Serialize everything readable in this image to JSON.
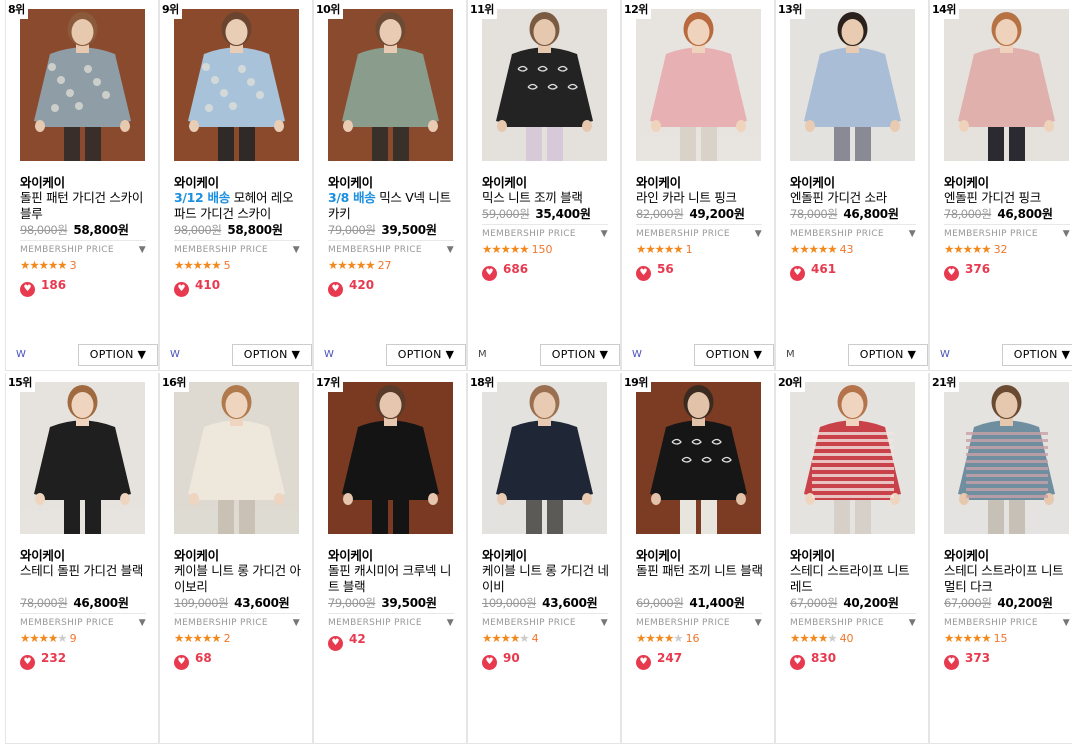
{
  "products": [
    {
      "rank": "8위",
      "brand": "와이케이",
      "ship": "",
      "name": "돌핀 패턴 가디건 스카이블루",
      "orig": "98,000원",
      "sale": "58,800원",
      "member": "MEMBERSHIP PRICE",
      "stars": 5,
      "rating": "3",
      "likes": "186",
      "flag": "W",
      "option": "OPTION ▼",
      "img": {
        "bg": "#8a4a2e",
        "top": "#8f9ea6",
        "pants": "#3a2e2a",
        "hair": "#8a5a3a",
        "skin": "#e7c9b0"
      }
    },
    {
      "rank": "9위",
      "brand": "와이케이",
      "ship": "3/12 배송",
      "name": "모헤어 레오파드 가디건 스카이",
      "orig": "98,000원",
      "sale": "58,800원",
      "member": "MEMBERSHIP PRICE",
      "stars": 5,
      "rating": "5",
      "likes": "410",
      "flag": "W",
      "option": "OPTION ▼",
      "img": {
        "bg": "#8b4a2c",
        "top": "#a8c3d9",
        "pants": "#2f2a28",
        "hair": "#6b4430",
        "skin": "#e9cdb5"
      }
    },
    {
      "rank": "10위",
      "brand": "와이케이",
      "ship": "3/8 배송",
      "name": "믹스 V넥 니트 카키",
      "orig": "79,000원",
      "sale": "39,500원",
      "member": "MEMBERSHIP PRICE",
      "stars": 5,
      "rating": "27",
      "likes": "420",
      "flag": "W",
      "option": "OPTION ▼",
      "img": {
        "bg": "#8a4a2d",
        "top": "#8a9c8c",
        "pants": "#3a302a",
        "hair": "#6d4a34",
        "skin": "#e8cbb2"
      }
    },
    {
      "rank": "11위",
      "brand": "와이케이",
      "ship": "",
      "name": "믹스 니트 조끼 블랙",
      "orig": "59,000원",
      "sale": "35,400원",
      "member": "MEMBERSHIP PRICE",
      "stars": 5,
      "rating": "150",
      "likes": "686",
      "flag": "M",
      "option": "OPTION ▼",
      "img": {
        "bg": "#e4e1dc",
        "top": "#232323",
        "pants": "#d8c9d8",
        "hair": "#7a5a40",
        "skin": "#e6c8ae"
      }
    },
    {
      "rank": "12위",
      "brand": "와이케이",
      "ship": "",
      "name": "라인 카라 니트 핑크",
      "orig": "82,000원",
      "sale": "49,200원",
      "member": "MEMBERSHIP PRICE",
      "stars": 5,
      "rating": "1",
      "likes": "56",
      "flag": "W",
      "option": "OPTION ▼",
      "img": {
        "bg": "#e7e4df",
        "top": "#e7b1b3",
        "pants": "#d9d2c8",
        "hair": "#b86a3e",
        "skin": "#efd3bd"
      }
    },
    {
      "rank": "13위",
      "brand": "와이케이",
      "ship": "",
      "name": "엔돌핀 가디건 소라",
      "orig": "78,000원",
      "sale": "46,800원",
      "member": "MEMBERSHIP PRICE",
      "stars": 5,
      "rating": "43",
      "likes": "461",
      "flag": "M",
      "option": "OPTION ▼",
      "img": {
        "bg": "#e4e2de",
        "top": "#a9bdd6",
        "pants": "#8a8a94",
        "hair": "#2b211c",
        "skin": "#e8cbb1"
      }
    },
    {
      "rank": "14위",
      "brand": "와이케이",
      "ship": "",
      "name": "엔돌핀 가디건 핑크",
      "orig": "78,000원",
      "sale": "46,800원",
      "member": "MEMBERSHIP PRICE",
      "stars": 5,
      "rating": "32",
      "likes": "376",
      "flag": "W",
      "option": "OPTION ▼",
      "img": {
        "bg": "#e5e2dd",
        "top": "#e0b0ad",
        "pants": "#2a2a30",
        "hair": "#b77244",
        "skin": "#eed2bb"
      }
    },
    {
      "rank": "15위",
      "brand": "와이케이",
      "ship": "",
      "name": "스테디 돌핀 가디건 블랙",
      "orig": "78,000원",
      "sale": "46,800원",
      "member": "MEMBERSHIP PRICE",
      "stars": 4,
      "rating": "9",
      "likes": "232",
      "flag": "",
      "option": "",
      "img": {
        "bg": "#e6e3de",
        "top": "#1f1f1f",
        "pants": "#1f1f1f",
        "hair": "#a06a40",
        "skin": "#efd5c0"
      }
    },
    {
      "rank": "16위",
      "brand": "와이케이",
      "ship": "",
      "name": "케이블 니트 롱 가디건 아이보리",
      "orig": "109,000원",
      "sale": "43,600원",
      "member": "MEMBERSHIP PRICE",
      "stars": 5,
      "rating": "2",
      "likes": "68",
      "flag": "",
      "option": "",
      "img": {
        "bg": "#dedad2",
        "top": "#ede7dc",
        "pants": "#c9c1b4",
        "hair": "#b07a4c",
        "skin": "#efd5c0"
      }
    },
    {
      "rank": "17위",
      "brand": "와이케이",
      "ship": "",
      "name": "돌핀 캐시미어 크루넥 니트 블랙",
      "orig": "79,000원",
      "sale": "39,500원",
      "member": "MEMBERSHIP PRICE",
      "stars": 0,
      "rating": "",
      "likes": "42",
      "flag": "",
      "option": "",
      "img": {
        "bg": "#7a3a22",
        "top": "#141414",
        "pants": "#141414",
        "hair": "#5a3a28",
        "skin": "#e6c6ae"
      }
    },
    {
      "rank": "18위",
      "brand": "와이케이",
      "ship": "",
      "name": "케이블 니트 롱 가디건 네이비",
      "orig": "109,000원",
      "sale": "43,600원",
      "member": "MEMBERSHIP PRICE",
      "stars": 4,
      "rating": "4",
      "likes": "90",
      "flag": "",
      "option": "",
      "img": {
        "bg": "#e3e2de",
        "top": "#1f2636",
        "pants": "#5b5a56",
        "hair": "#9a7050",
        "skin": "#e8cbb2"
      }
    },
    {
      "rank": "19위",
      "brand": "와이케이",
      "ship": "",
      "name": "돌핀 패턴 조끼 니트 블랙",
      "orig": "69,000원",
      "sale": "41,400원",
      "member": "MEMBERSHIP PRICE",
      "stars": 4,
      "rating": "16",
      "likes": "247",
      "flag": "",
      "option": "",
      "img": {
        "bg": "#7c3c24",
        "top": "#161616",
        "pants": "#e8e4de",
        "hair": "#3a2a20",
        "skin": "#e2c2a8"
      }
    },
    {
      "rank": "20위",
      "brand": "와이케이",
      "ship": "",
      "name": "스테디 스트라이프 니트 레드",
      "orig": "67,000원",
      "sale": "40,200원",
      "member": "MEMBERSHIP PRICE",
      "stars": 4,
      "rating": "40",
      "likes": "830",
      "flag": "",
      "option": "",
      "img": {
        "bg": "#e5e3df",
        "top": "#c9424a",
        "pants": "#d6d0c8",
        "hair": "#b4734a",
        "skin": "#efd5c0"
      }
    },
    {
      "rank": "21위",
      "brand": "와이케이",
      "ship": "",
      "name": "스테디 스트라이프 니트 멀티 다크",
      "orig": "67,000원",
      "sale": "40,200원",
      "member": "MEMBERSHIP PRICE",
      "stars": 5,
      "rating": "15",
      "likes": "373",
      "flag": "",
      "option": "",
      "img": {
        "bg": "#e4e3e0",
        "top": "#6f8fa0",
        "pants": "#c7c0b6",
        "hair": "#6a4a30",
        "skin": "#e6c8ae"
      }
    }
  ],
  "accent": "#e83a4f",
  "ship_color": "#1a8fe0",
  "star_color": "#f2891f"
}
